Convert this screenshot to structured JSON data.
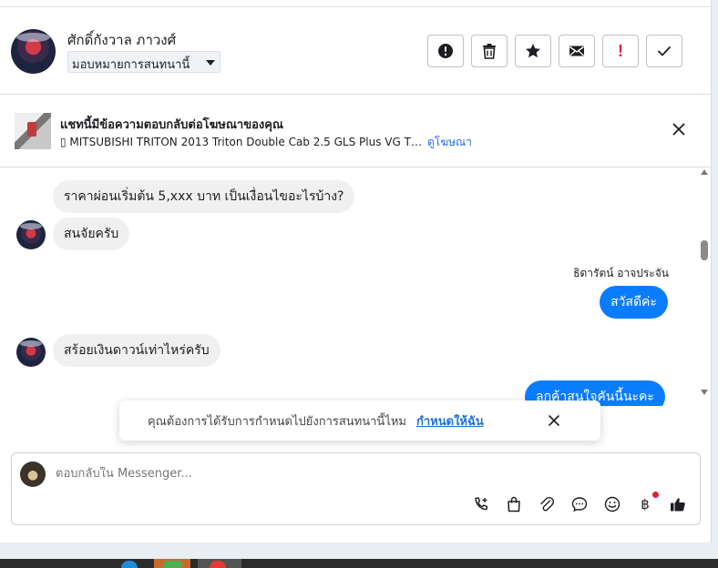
{
  "header": {
    "contact_name": "ศักดิ์กังวาล ภาวงศ์",
    "assign_label": "มอบหมายการสนทนานี้",
    "actions": [
      {
        "name": "mark-spam-button",
        "icon": "alert-circle-icon"
      },
      {
        "name": "delete-button",
        "icon": "trash-icon"
      },
      {
        "name": "star-button",
        "icon": "star-icon"
      },
      {
        "name": "mark-unread-button",
        "icon": "envelope-icon"
      },
      {
        "name": "follow-up-button",
        "icon": "exclamation-icon",
        "text": "!"
      },
      {
        "name": "mark-done-button",
        "icon": "check-icon"
      }
    ]
  },
  "ad_banner": {
    "title": "แชทนี้มีข้อความตอบกลับต่อโฆษณาของคุณ",
    "ad_text": "▯ MITSUBISHI TRITON 2013 Triton Double Cab 2.5 GLS Plus VG T…",
    "view_ad_link": "ดูโฆษณา"
  },
  "messages": [
    {
      "direction": "in",
      "text": "ราคาผ่อนเริ่มต้น 5,xxx บาท เป็นเงื่อนไขอะไรบ้าง?",
      "show_avatar": false
    },
    {
      "direction": "in",
      "text": "สนจัยครับ",
      "show_avatar": true
    },
    {
      "direction": "out",
      "sender": "ธิดารัตน์ อาจประจัน",
      "text": "สวัสดีค่ะ"
    },
    {
      "direction": "in",
      "text": "สร้อยเงินดาวน์เท่าไหร่ครับ",
      "show_avatar": true
    },
    {
      "direction": "out",
      "text": "ลูกค้าสนใจคันนี้นะคะ"
    }
  ],
  "toast": {
    "text": "คุณต้องการได้รับการกำหนดไปยังการสนทนานี้ไหม",
    "link": "กำหนดให้ฉัน"
  },
  "composer": {
    "placeholder": "ตอบกลับใน Messenger...",
    "tools": [
      "call-icon",
      "shopping-bag-icon",
      "paperclip-icon",
      "chat-bubble-icon",
      "smiley-icon",
      "baht-icon",
      "thumbs-up-icon"
    ],
    "baht_symbol": "฿"
  },
  "colors": {
    "accent": "#0a7cff",
    "link": "#216fdb",
    "incoming_bubble": "#f0f0f0",
    "alert_red": "#e41e3f"
  }
}
